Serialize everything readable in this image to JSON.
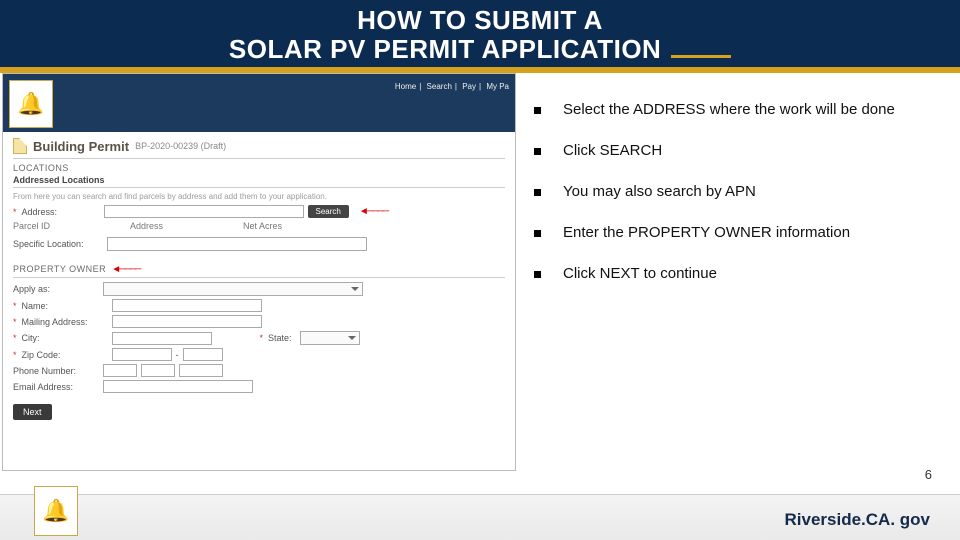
{
  "title_l1": "HOW TO SUBMIT A",
  "title_l2": "SOLAR PV PERMIT APPLICATION",
  "nav": {
    "home": "Home",
    "search": "Search",
    "pay": "Pay",
    "my": "My Pa"
  },
  "bp": {
    "title": "Building Permit",
    "num": "BP-2020-00239 (Draft)"
  },
  "loc": {
    "head": "LOCATIONS",
    "sub": "Addressed Locations",
    "hint": "From here you can search and find parcels by address and add them to your application.",
    "addr_label": "Address:",
    "search_btn": "Search",
    "parcel": "Parcel ID",
    "addr_col": "Address",
    "net": "Net Acres",
    "spec": "Specific Location:"
  },
  "po": {
    "head": "PROPERTY OWNER",
    "apply": "Apply as:",
    "name": "Name:",
    "mail": "Mailing Address:",
    "city": "City:",
    "state": "State:",
    "zip": "Zip Code:",
    "phone": "Phone Number:",
    "email": "Email Address:"
  },
  "next": "Next",
  "bullets": [
    "Select the ADDRESS where the work will be done",
    "Click SEARCH",
    "You may also search by APN",
    "Enter the PROPERTY OWNER information",
    "Click NEXT to continue"
  ],
  "page_num": "6",
  "site": "Riverside.CA. gov"
}
